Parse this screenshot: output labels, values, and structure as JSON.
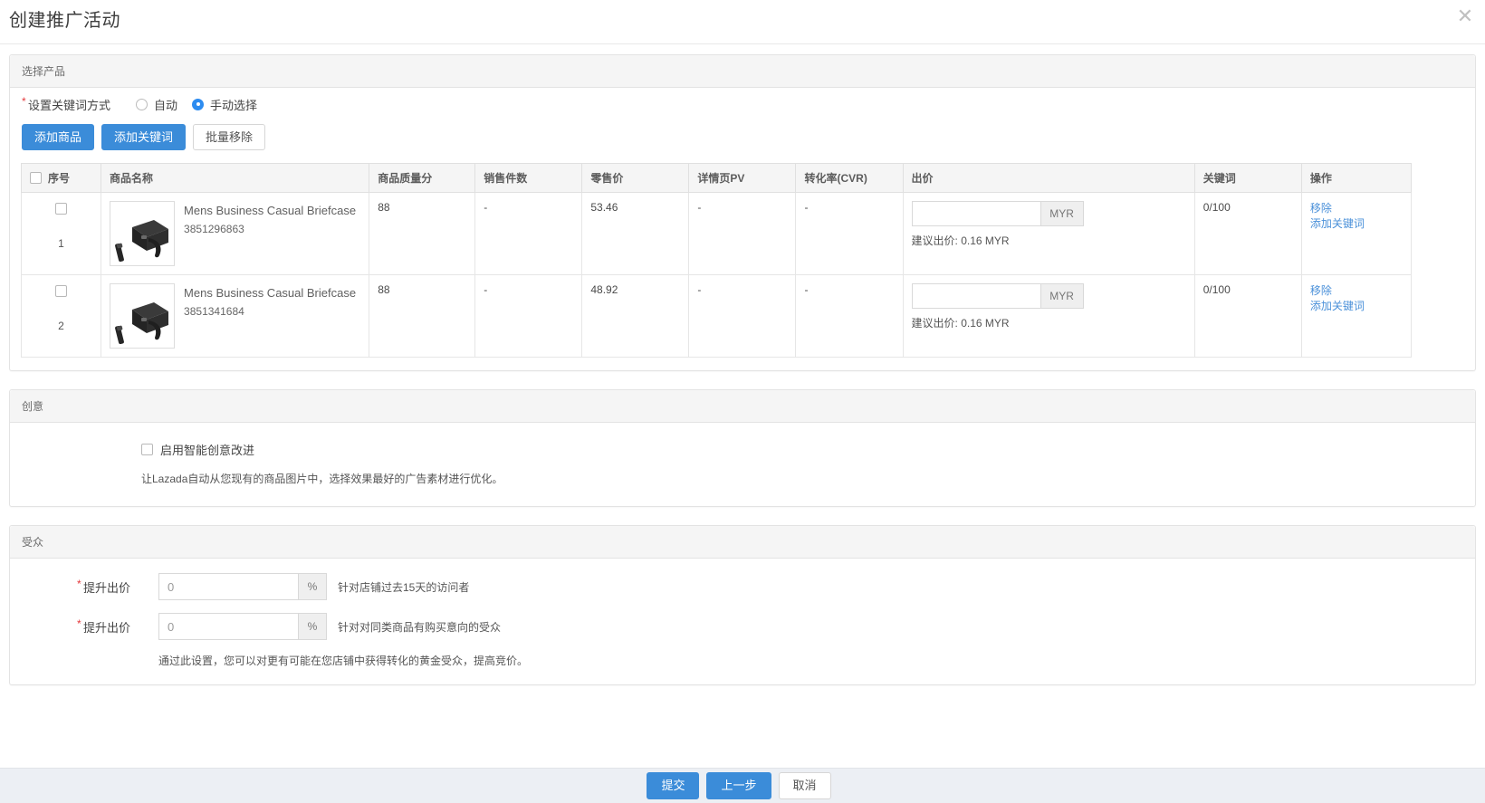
{
  "dialog": {
    "title": "创建推广活动",
    "close_icon": "close-icon"
  },
  "sections": {
    "product": {
      "heading": "选择产品",
      "keyword_mode_label": "设置关键词方式",
      "required_star": "*",
      "radio_options": [
        {
          "label": "自动",
          "checked": false
        },
        {
          "label": "手动选择",
          "checked": true
        }
      ],
      "buttons": {
        "add_product": "添加商品",
        "add_keyword": "添加关键词",
        "batch_remove": "批量移除"
      },
      "table": {
        "columns": [
          "序号",
          "商品名称",
          "商品质量分",
          "销售件数",
          "零售价",
          "详情页PV",
          "转化率(CVR)",
          "出价",
          "关键词",
          "操作"
        ],
        "bid_unit": "MYR",
        "bid_placeholder": "",
        "rows": [
          {
            "index": "1",
            "name": "Mens Business Casual Briefcase",
            "item_id": "3851296863",
            "quality_score": "88",
            "sold": "-",
            "retail_price": "53.46",
            "detail_pv": "-",
            "cvr": "-",
            "bid_value": "",
            "bid_hint": "建议出价: 0.16 MYR",
            "keywords": "0/100",
            "actions": [
              "移除",
              "添加关键词"
            ]
          },
          {
            "index": "2",
            "name": "Mens Business Casual Briefcase",
            "item_id": "3851341684",
            "quality_score": "88",
            "sold": "-",
            "retail_price": "48.92",
            "detail_pv": "-",
            "cvr": "-",
            "bid_value": "",
            "bid_hint": "建议出价: 0.16 MYR",
            "keywords": "0/100",
            "actions": [
              "移除",
              "添加关键词"
            ]
          }
        ]
      }
    },
    "creative": {
      "heading": "创意",
      "checkbox_label": "启用智能创意改进",
      "checked": false,
      "note": "让Lazada自动从您现有的商品图片中，选择效果最好的广告素材进行优化。"
    },
    "audience": {
      "heading": "受众",
      "rows": [
        {
          "label": "提升出价",
          "value": "",
          "placeholder": "0",
          "unit": "%",
          "description": "针对店铺过去15天的访问者"
        },
        {
          "label": "提升出价",
          "value": "",
          "placeholder": "0",
          "unit": "%",
          "description": "针对对同类商品有购买意向的受众"
        }
      ],
      "note": "通过此设置，您可以对更有可能在您店铺中获得转化的黄金受众，提高竞价。"
    }
  },
  "footer": {
    "submit": "提交",
    "previous": "上一步",
    "cancel": "取消"
  },
  "colors": {
    "primary": "#3b8cd9",
    "link": "#4a90d9",
    "required": "#e4393c",
    "panel_head_bg": "#f5f5f5",
    "footer_bg": "#eceff4"
  }
}
